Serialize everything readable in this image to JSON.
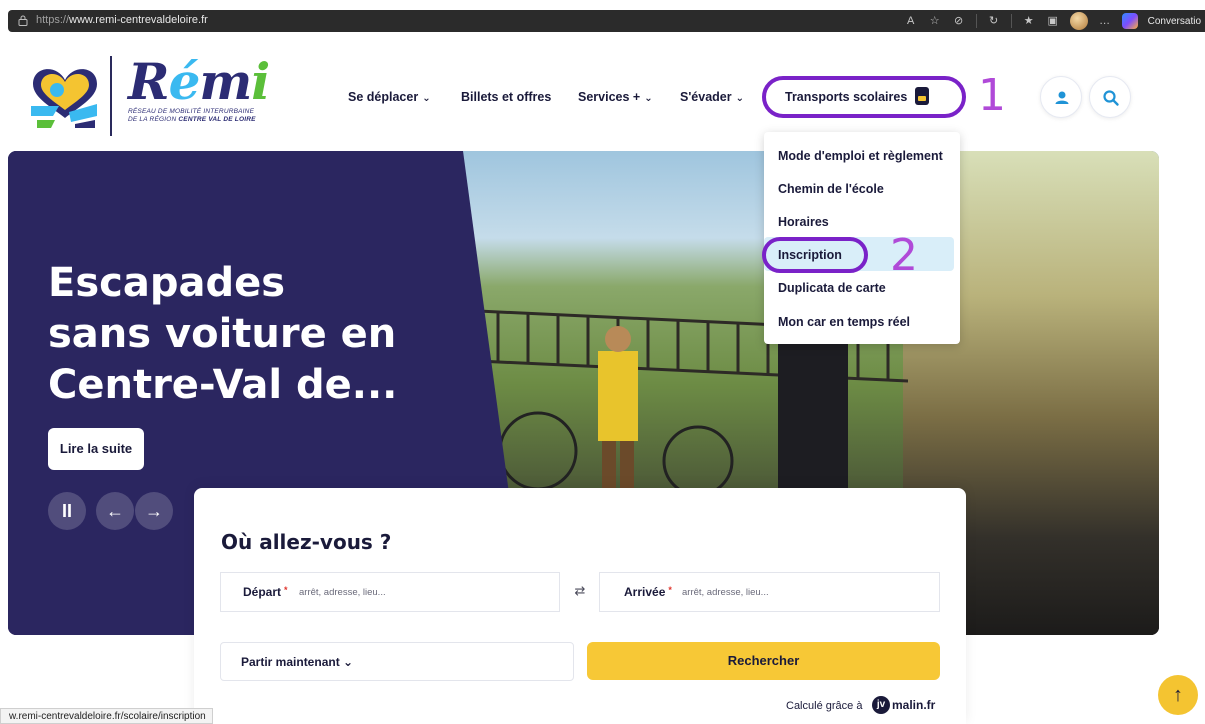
{
  "browser": {
    "url_proto": "https://",
    "url_host": "www.remi-centrevaldeloire.fr",
    "conversation_label": "Conversatio",
    "status_url": "w.remi-centrevaldeloire.fr/scolaire/inscription"
  },
  "header": {
    "logo_word_r": "R",
    "logo_word_e": "é",
    "logo_word_m": "m",
    "logo_word_i": "i",
    "logo_tag_line1": "RÉSEAU DE MOBILITÉ INTERURBAINE",
    "logo_tag_line2a": "DE LA RÉGION ",
    "logo_tag_line2b": "CENTRE VAL DE LOIRE"
  },
  "nav": {
    "items": [
      {
        "label": "Se déplacer",
        "chevron": "⌄"
      },
      {
        "label": "Billets et offres",
        "chevron": ""
      },
      {
        "label": "Services +",
        "chevron": "⌄"
      },
      {
        "label": "S'évader",
        "chevron": "⌄"
      },
      {
        "label": "Transports scolaires",
        "icon": "backpack-icon"
      }
    ]
  },
  "annotations": {
    "first": "1",
    "second": "2"
  },
  "dropdown": {
    "items": [
      "Mode d'emploi et règlement",
      "Chemin de l'école",
      "Horaires",
      "Inscription",
      "Duplicata de carte",
      "Mon car en temps réel"
    ],
    "highlighted_index": 3
  },
  "hero": {
    "title_lines": [
      "Escapades",
      "sans voiture en",
      "Centre-Val de..."
    ],
    "read_more": "Lire la suite",
    "controls": {
      "pause": "II",
      "prev": "←",
      "next": "→"
    }
  },
  "search": {
    "title": "Où allez-vous ?",
    "depart_label": "Départ",
    "depart_placeholder": "arrêt, adresse, lieu...",
    "arrivee_label": "Arrivée",
    "arrivee_placeholder": "arrêt, adresse, lieu...",
    "required_mark": "*",
    "swap_icon": "⇄",
    "when_label": "Partir maintenant",
    "when_chevron": "⌄",
    "submit_label": "Rechercher",
    "powered_by": "Calculé grâce à",
    "powered_brand": "malin.fr",
    "powered_logo": "jv"
  },
  "back_to_top": "↑",
  "colors": {
    "navy": "#2b2660",
    "accent_yellow": "#f7c836",
    "annotation_purple": "#7a22c8",
    "highlight": "#d9eef9"
  }
}
